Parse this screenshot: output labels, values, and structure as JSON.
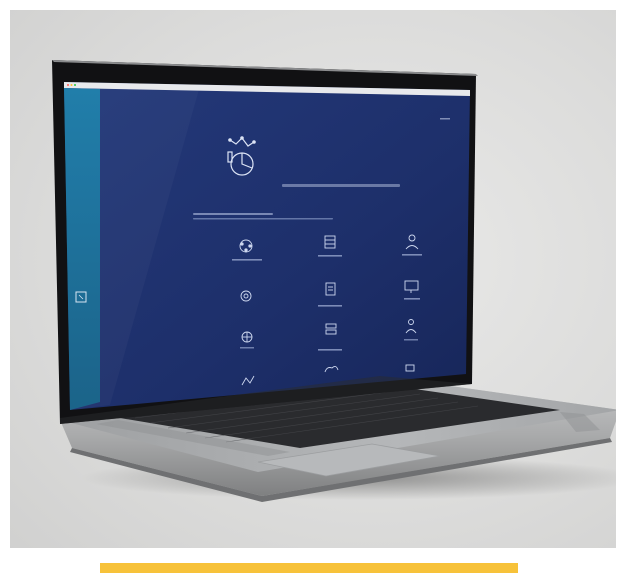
{
  "scene": {
    "description_label": "",
    "colors": {
      "background": "#dcdcdb",
      "screen_bg": "#1d2f6a",
      "sidebar_teal": "#1a6f9a",
      "laptop_silver": "#b9babb",
      "bezel": "#111113",
      "accent_bar": "#f7c23a"
    }
  },
  "screen": {
    "title": "",
    "subtitle": "",
    "subtitle2": "",
    "tiles": [
      {
        "icon": "cluster-icon",
        "label": ""
      },
      {
        "icon": "database-icon",
        "label": ""
      },
      {
        "icon": "user-icon",
        "label": ""
      },
      {
        "icon": "gear-icon",
        "label": ""
      },
      {
        "icon": "document-icon",
        "label": ""
      },
      {
        "icon": "monitor-icon",
        "label": ""
      },
      {
        "icon": "network-icon",
        "label": ""
      },
      {
        "icon": "stack-icon",
        "label": ""
      },
      {
        "icon": "person-icon",
        "label": ""
      },
      {
        "icon": "chart-icon",
        "label": ""
      },
      {
        "icon": "cloud-icon",
        "label": ""
      },
      {
        "icon": "grid-icon",
        "label": ""
      }
    ],
    "sidebar_icon": "sidebar-logo-icon",
    "hero_icon": "analytics-logo-icon"
  }
}
